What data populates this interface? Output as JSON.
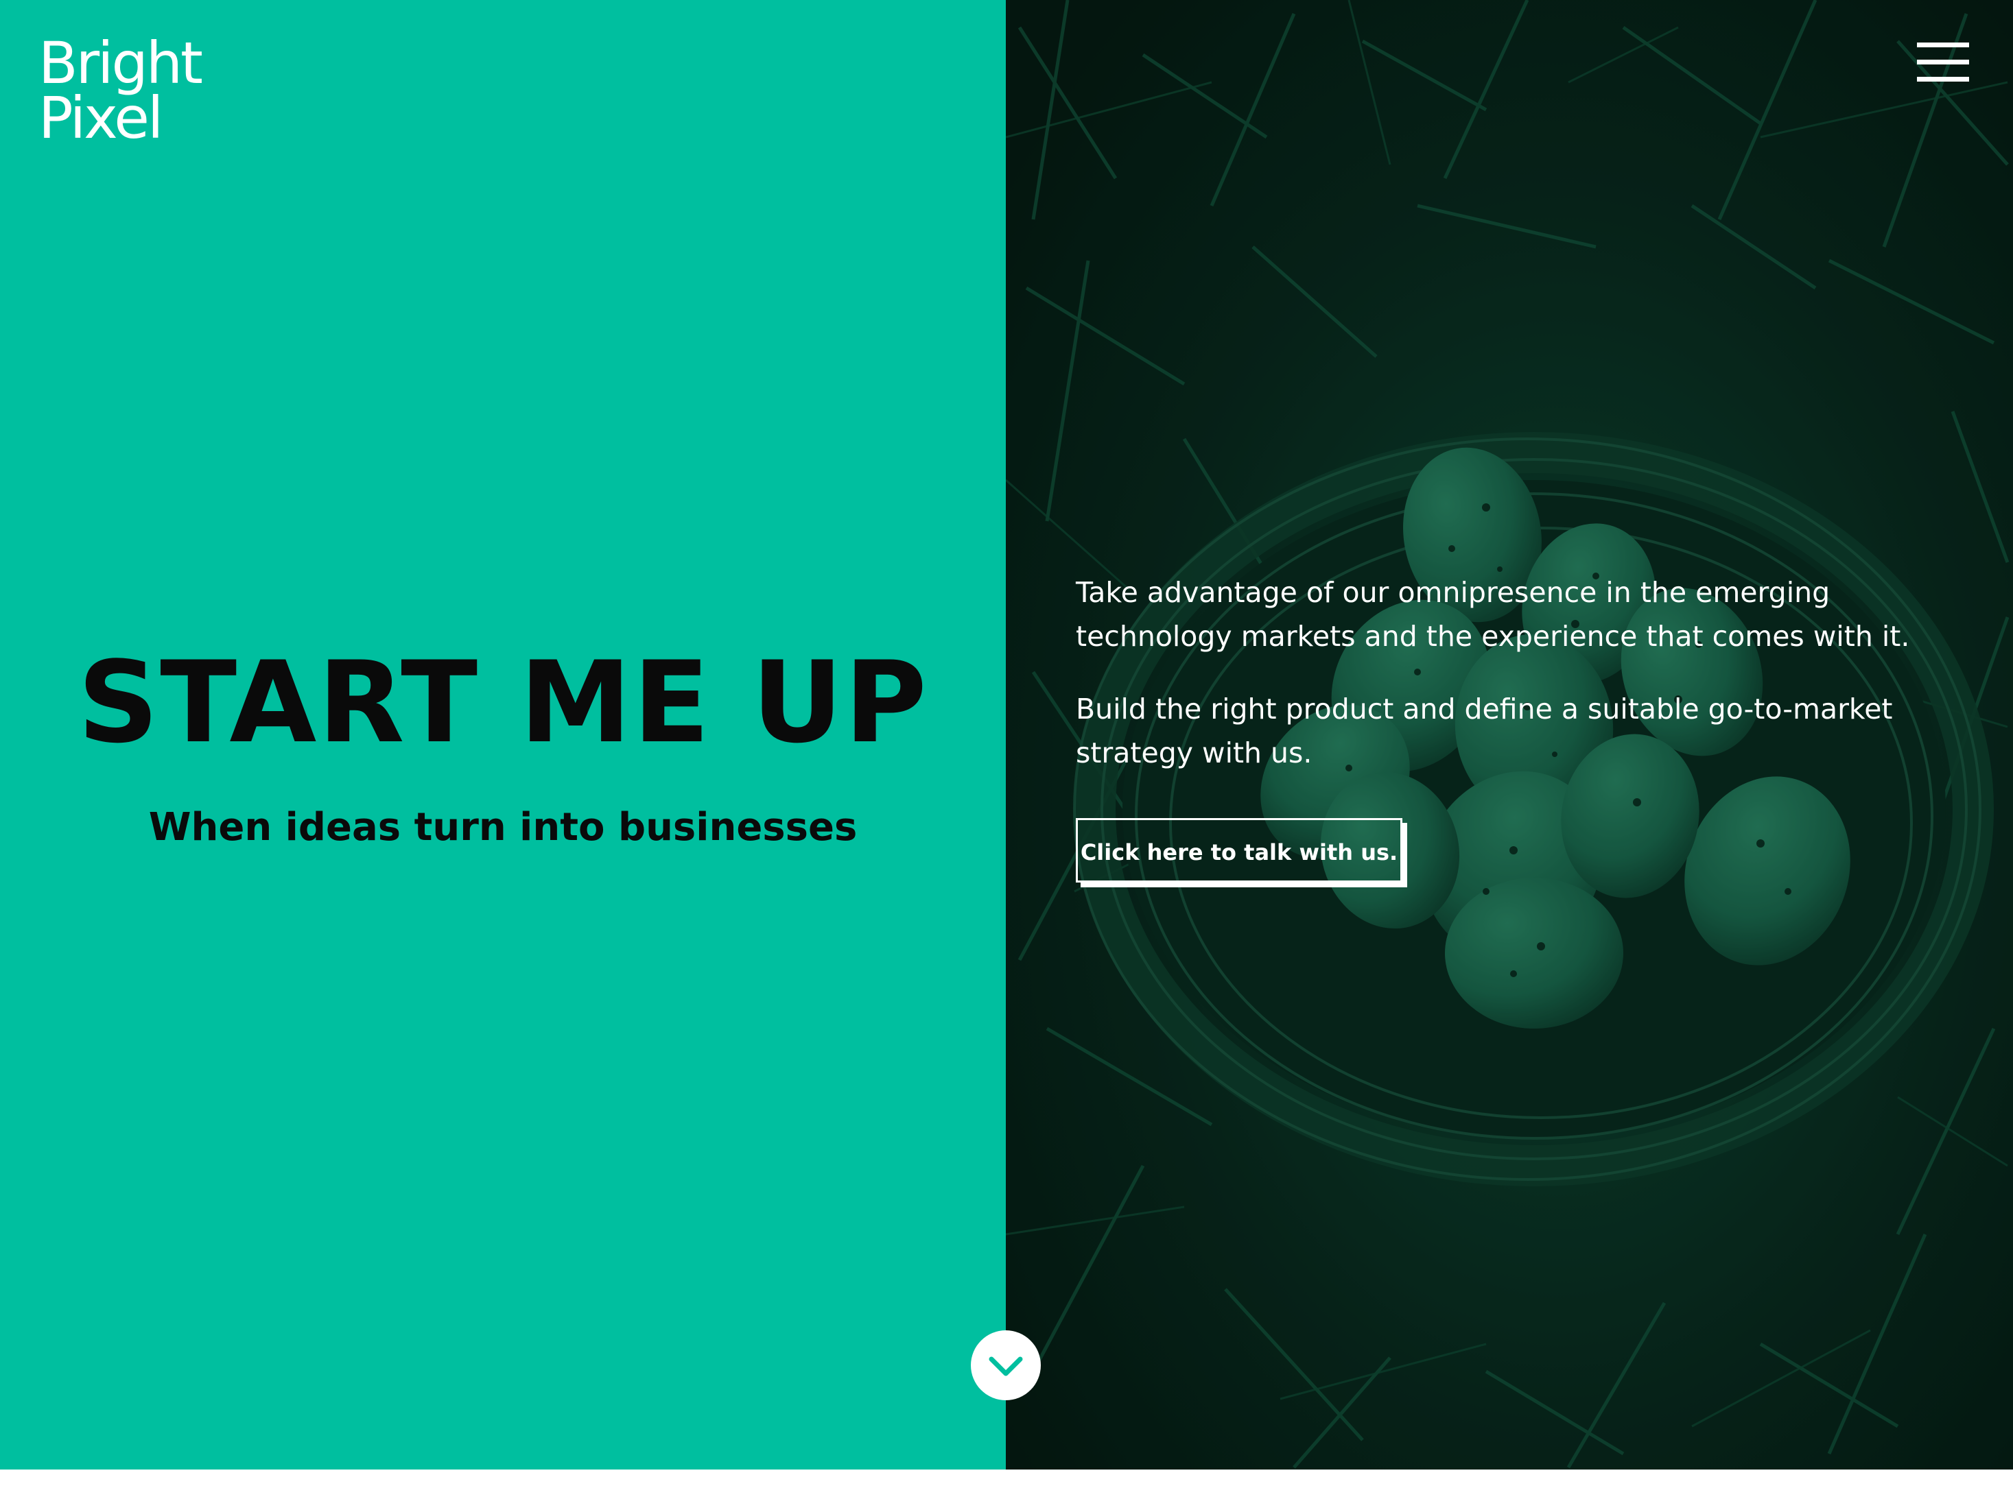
{
  "brand": {
    "logo_line1": "Bright",
    "logo_line2": "Pixel"
  },
  "header": {
    "menu_icon": "hamburger-menu-icon"
  },
  "hero": {
    "title": "START ME UP",
    "subtitle": "When ideas turn into businesses"
  },
  "right": {
    "paragraph1": "Take advantage of our omnipresence in the emerging technology markets and the experience that comes with it.",
    "paragraph2": "Build the right product and define a suitable go-to-market strategy with us.",
    "cta_label": "Click here to talk with us.",
    "background_image": "eggs-in-nest-photo"
  },
  "scroll": {
    "icon": "chevron-down-icon"
  },
  "colors": {
    "accent": "#00bf9f",
    "dark_green": "#06231a",
    "text_dark": "#0a0a0a",
    "text_light": "#ffffff"
  }
}
